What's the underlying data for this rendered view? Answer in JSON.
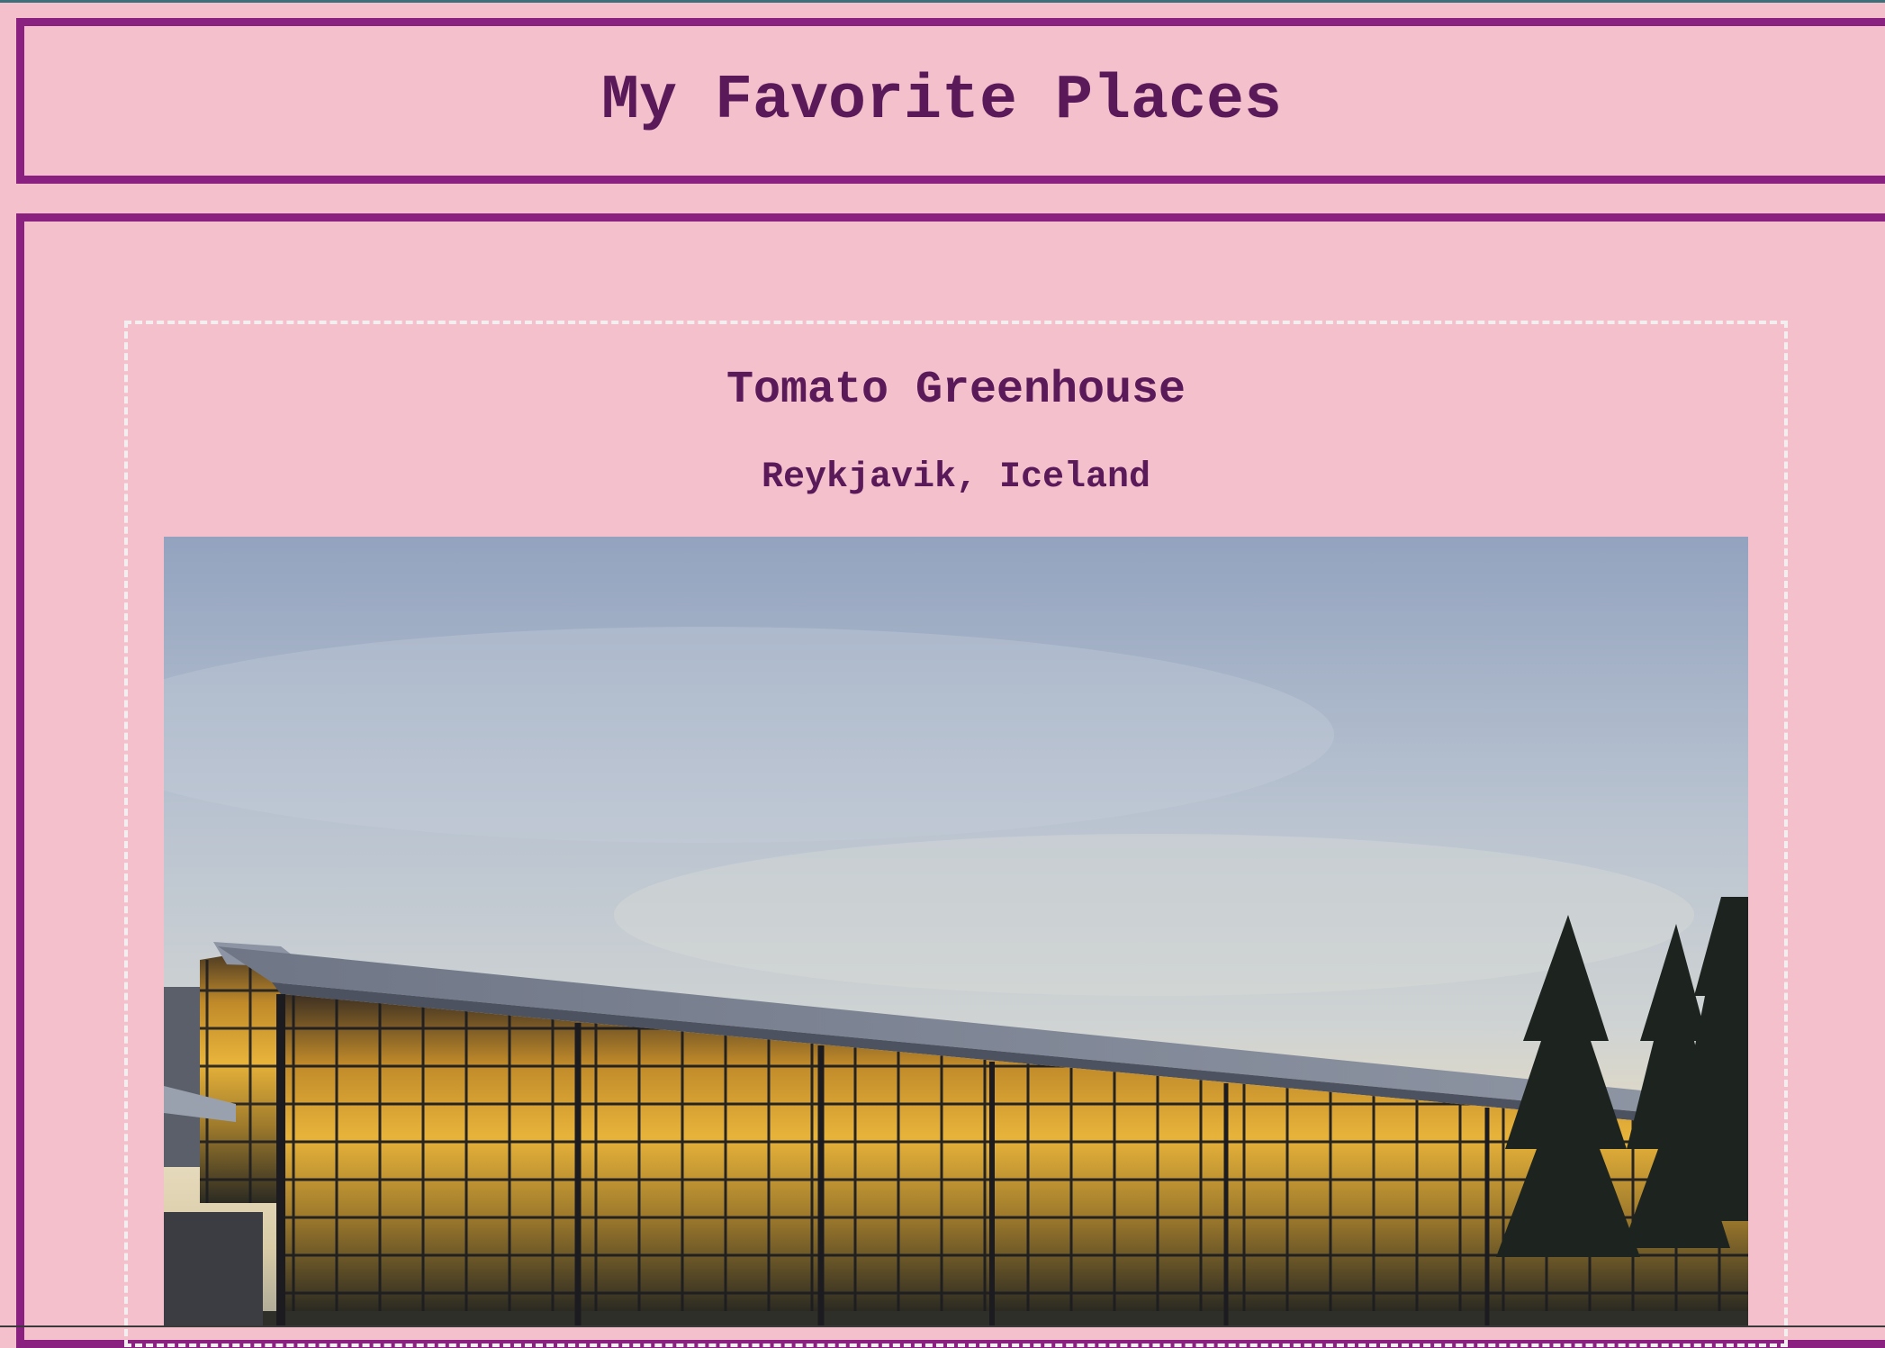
{
  "header": {
    "title": "My Favorite Places"
  },
  "places": [
    {
      "name": "Tomato Greenhouse",
      "location": "Reykjavik, Iceland",
      "photo": "greenhouse-photo"
    }
  ],
  "colors": {
    "background": "#f4c0cc",
    "border": "#8a2080",
    "text": "#5a1a5a",
    "card_border": "#f3eef0"
  }
}
